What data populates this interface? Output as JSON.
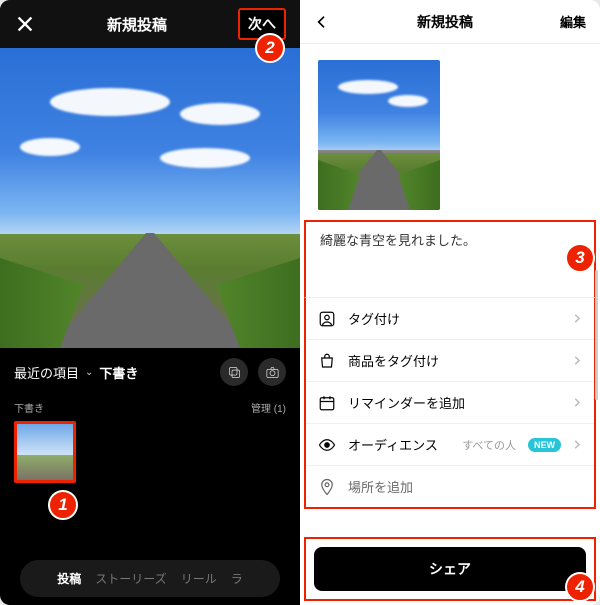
{
  "left": {
    "title": "新規投稿",
    "next": "次へ",
    "album": {
      "recent": "最近の項目",
      "draft": "下書き"
    },
    "drafts": {
      "label": "下書き",
      "manage": "管理",
      "count": "(1)"
    },
    "tabs": {
      "post": "投稿",
      "stories": "ストーリーズ",
      "reels": "リール",
      "live": "ラ"
    }
  },
  "right": {
    "title": "新規投稿",
    "edit": "編集",
    "caption": "綺麗な青空を見れました。",
    "opts": {
      "tag": "タグ付け",
      "product": "商品をタグ付け",
      "reminder": "リマインダーを追加",
      "audience": "オーディエンス",
      "audience_val": "すべての人",
      "new": "NEW",
      "location": "場所を追加"
    },
    "share": "シェア"
  },
  "badges": {
    "b1": "1",
    "b2": "2",
    "b3": "3",
    "b4": "4"
  }
}
